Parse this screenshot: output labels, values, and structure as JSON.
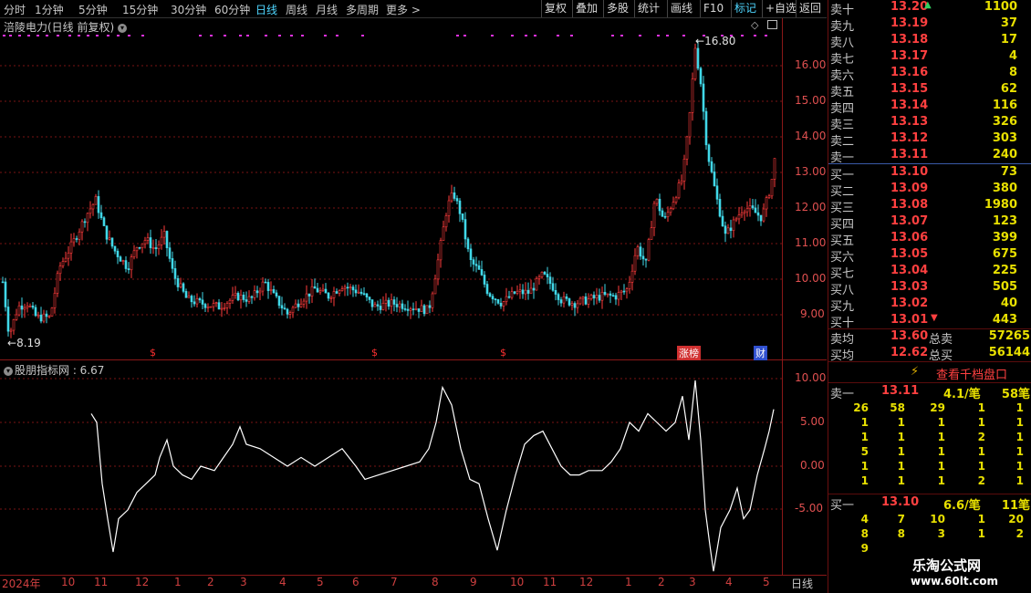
{
  "toolbar": {
    "periods": [
      "分时",
      "1分钟",
      "5分钟",
      "15分钟",
      "30分钟",
      "60分钟",
      "日线",
      "周线",
      "月线",
      "多周期",
      "更多 >"
    ],
    "active_period": "日线",
    "actions": [
      "复权",
      "叠加",
      "多股",
      "统计",
      "画线",
      "F10",
      "标记",
      "+自选",
      "返回"
    ]
  },
  "main_chart": {
    "title": "涪陵电力(日线 前复权)",
    "high_label": "16.80",
    "low_label": "8.19",
    "y_ticks": [
      "16.00",
      "15.00",
      "14.00",
      "13.00",
      "12.00",
      "11.00",
      "10.00",
      "9.00"
    ],
    "markers": [
      "$",
      "$",
      "$",
      "涨榜",
      "财"
    ]
  },
  "indicator": {
    "title": "股朋指标网 : 6.67",
    "y_ticks": [
      "10.00",
      "5.00",
      "0.00",
      "-5.00"
    ]
  },
  "date_axis": {
    "labels": [
      "2024年",
      "10",
      "11",
      "12",
      "1",
      "2",
      "3",
      "4",
      "5",
      "6",
      "7",
      "8",
      "9",
      "10",
      "11",
      "12",
      "1",
      "2",
      "3",
      "4",
      "5"
    ],
    "period": "日线"
  },
  "order_book": {
    "asks": [
      {
        "label": "卖十",
        "price": "13.20",
        "vol": "1100"
      },
      {
        "label": "卖九",
        "price": "13.19",
        "vol": "37"
      },
      {
        "label": "卖八",
        "price": "13.18",
        "vol": "17"
      },
      {
        "label": "卖七",
        "price": "13.17",
        "vol": "4"
      },
      {
        "label": "卖六",
        "price": "13.16",
        "vol": "8"
      },
      {
        "label": "卖五",
        "price": "13.15",
        "vol": "62"
      },
      {
        "label": "卖四",
        "price": "13.14",
        "vol": "116"
      },
      {
        "label": "卖三",
        "price": "13.13",
        "vol": "326"
      },
      {
        "label": "卖二",
        "price": "13.12",
        "vol": "303"
      },
      {
        "label": "卖一",
        "price": "13.11",
        "vol": "240"
      }
    ],
    "bids": [
      {
        "label": "买一",
        "price": "13.10",
        "vol": "73"
      },
      {
        "label": "买二",
        "price": "13.09",
        "vol": "380"
      },
      {
        "label": "买三",
        "price": "13.08",
        "vol": "1980"
      },
      {
        "label": "买四",
        "price": "13.07",
        "vol": "123"
      },
      {
        "label": "买五",
        "price": "13.06",
        "vol": "399"
      },
      {
        "label": "买六",
        "price": "13.05",
        "vol": "675"
      },
      {
        "label": "买七",
        "price": "13.04",
        "vol": "225"
      },
      {
        "label": "买八",
        "price": "13.03",
        "vol": "505"
      },
      {
        "label": "买九",
        "price": "13.02",
        "vol": "40"
      },
      {
        "label": "买十",
        "price": "13.01",
        "vol": "443"
      }
    ],
    "avg_sell_label": "卖均",
    "avg_sell": "13.60",
    "total_sell_label": "总卖",
    "total_sell": "57265",
    "avg_buy_label": "买均",
    "avg_buy": "12.62",
    "total_buy_label": "总买",
    "total_buy": "56144",
    "view_thousand": "查看千档盘口",
    "sell1": {
      "label": "卖一",
      "price": "13.11",
      "per": "4.1/笔",
      "count": "58笔"
    },
    "sell1_grid": [
      [
        "26",
        "58",
        "29",
        "1",
        "1"
      ],
      [
        "1",
        "1",
        "1",
        "1",
        "1"
      ],
      [
        "1",
        "1",
        "1",
        "2",
        "1"
      ],
      [
        "5",
        "1",
        "1",
        "1",
        "1"
      ],
      [
        "1",
        "1",
        "1",
        "1",
        "1"
      ],
      [
        "1",
        "1",
        "1",
        "2",
        "1"
      ]
    ],
    "buy1": {
      "label": "买一",
      "price": "13.10",
      "per": "6.6/笔",
      "count": "11笔"
    },
    "buy1_grid": [
      [
        "4",
        "7",
        "10",
        "1",
        "20"
      ],
      [
        "8",
        "8",
        "3",
        "1",
        "2"
      ],
      [
        "9",
        "",
        "",
        "",
        ""
      ]
    ],
    "watermark_title": "乐淘公式网",
    "watermark_url": "www.60lt.com"
  },
  "colors": {
    "up": "#ff3c3c",
    "down": "#40d8e8",
    "grid": "#7a1414",
    "ma": "#ffffff"
  }
}
